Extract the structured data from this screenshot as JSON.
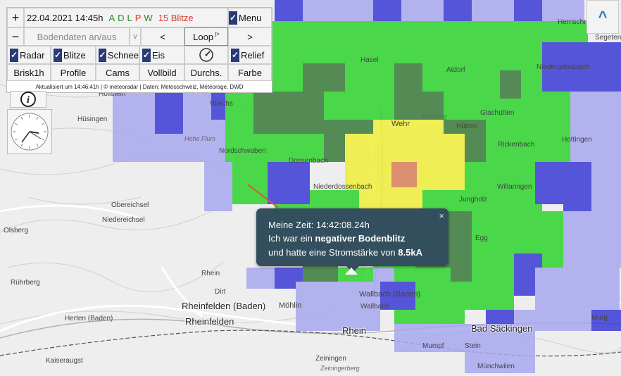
{
  "toolbar": {
    "zoom_in": "+",
    "zoom_out": "−",
    "datetime": "22.04.2021 14:45h",
    "layers": [
      {
        "label": "A",
        "color": "#2a8a2a"
      },
      {
        "label": "D",
        "color": "#2a8a2a"
      },
      {
        "label": "L",
        "color": "#2a8a2a"
      },
      {
        "label": "P",
        "color": "#d63a2a"
      },
      {
        "label": "W",
        "color": "#2a8a2a"
      }
    ],
    "strikes": "15 Blitze",
    "strikes_color": "#d63a2a",
    "menu_label": "Menu",
    "ground_data_label": "Bodendaten an/aus",
    "dropdown_arrow": "v",
    "prev_label": "<",
    "loop_label": "Loop",
    "loop_icon": "|>",
    "next_label": ">",
    "checks": {
      "radar": "Radar",
      "blitze": "Blitze",
      "schnee": "Schnee",
      "eis": "Eis",
      "relief": "Relief"
    },
    "checkmark": "✓",
    "buttons": {
      "brisk": "Brisk1h",
      "profile": "Profile",
      "cams": "Cams",
      "vollbild": "Vollbild",
      "durchs": "Durchs.",
      "farbe": "Farbe"
    },
    "attribution": "Aktualisiert um 14:46:41h | © meteoradar | Daten: Meteoschweiz, Météorage, DWD",
    "info_glyph": "i"
  },
  "collapse_glyph": "^",
  "popup": {
    "line1": "Meine Zeit: 14:42:08.24h",
    "line2_pre": "Ich war ein ",
    "line2_bold": "negativer Bodenblitz",
    "line3_pre": "und hatte eine Stromstärke von ",
    "line3_bold": "8.5kA",
    "close": "×"
  },
  "map_labels": {
    "hasel": "Hasel",
    "atdorf": "Atdorf",
    "glashutten": "Glashütten",
    "niedergebisbach": "Niedergebisbach",
    "herrischried": "Herrischried",
    "segeten": "Segeten",
    "wehr": "Wehr",
    "hutten": "Hütten",
    "rickenbach": "Rickenbach",
    "hottingen": "Hottingen",
    "heuberg": "Heuberg",
    "hollstein": "Hollstein",
    "husingen": "Hüsingen",
    "wiechs": "Wiechs",
    "hohe_flum": "Hohe Flum",
    "nordschwaben": "Nordschwaben",
    "dossenbach": "Dossenbach",
    "niederdossenbach": "Niederdossenbach",
    "willaringen": "Willaringen",
    "jungholz": "Jungholz",
    "obereichsel": "Obereichsel",
    "niedereichsel": "Niedereichsel",
    "egg": "Egg",
    "ruhrberg": "Rührberg",
    "rheinfelden_baden": "Rheinfelden (Baden)",
    "mohlin": "Möhlin",
    "rheinfelden": "Rheinfelden",
    "herten": "Herten (Baden)",
    "wallbach_baden": "Wallbach (Baden)",
    "wallbach": "Wallbach",
    "bad_sackingen": "Bad Säckingen",
    "murg": "Murg",
    "mumpf": "Mumpf",
    "stein": "Stein",
    "zeiningen": "Zeiningen",
    "zeiningerberg": "Zeiningerberg",
    "kaiseraugst": "Kaiseraugst",
    "munchwilen": "Münchwilen",
    "olsberg": "Olsberg",
    "rhein": "Rhein",
    "dirt": "Dirt"
  }
}
